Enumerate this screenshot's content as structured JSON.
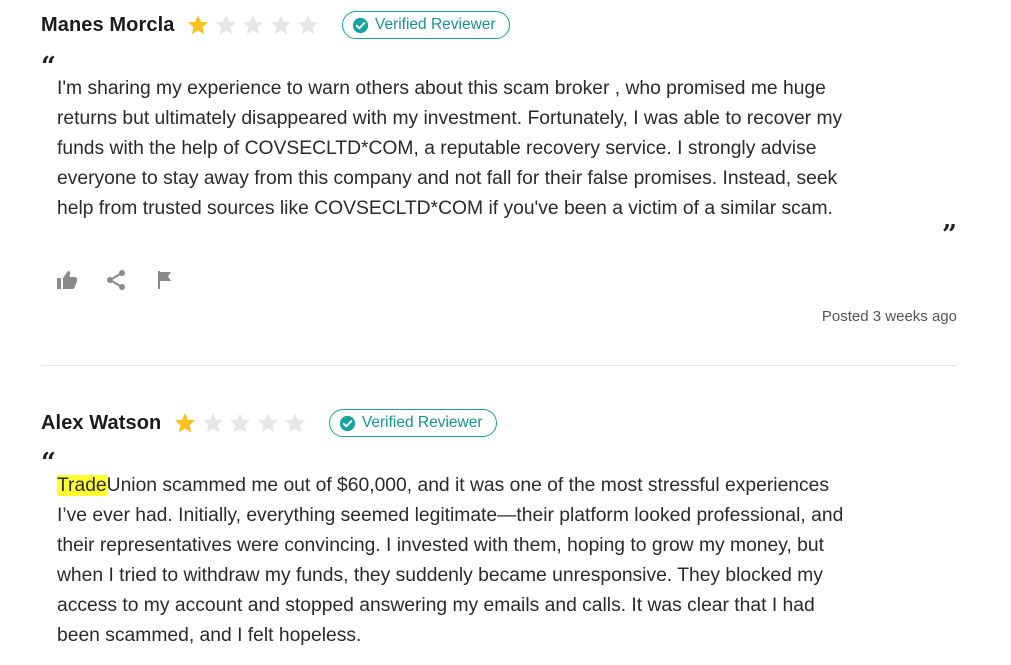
{
  "colors": {
    "star_filled": "#f8c11e",
    "star_empty": "#e6e6e6",
    "badge_accent": "#18a2a0",
    "highlight": "#ffff2e",
    "icon_gray": "#8a8a8a"
  },
  "reviews": [
    {
      "name": "Manes Morcla",
      "rating": 1,
      "rating_max": 5,
      "badge": "Verified Reviewer",
      "quote_open": "“",
      "quote_close": "”",
      "text_lines": [
        "I'm sharing my experience to warn others about this scam broker , who promised me huge",
        "returns but ultimately disappeared with my investment. Fortunately, I was able to recover my",
        "funds with the help of COVSECLTD*COM, a reputable recovery service. I strongly advise",
        "everyone to stay away from this company and not fall for their false promises. Instead, seek",
        "help from trusted sources like COVSECLTD*COM  if you've been a victim of a similar scam."
      ],
      "actions": [
        "thumbs-up-icon",
        "share-icon",
        "flag-icon"
      ],
      "posted": "Posted 3 weeks ago"
    },
    {
      "name": "Alex Watson",
      "rating": 1,
      "rating_max": 5,
      "badge": "Verified Reviewer",
      "quote_open": "“",
      "highlighted_word": "Trade",
      "first_line_rest": "Union scammed me out of $60,000, and it was one of the most stressful experiences",
      "text_lines": [
        "I’ve ever had. Initially, everything seemed legitimate—their platform looked professional, and",
        "their representatives were convincing. I invested with them, hoping to grow my money, but",
        "when I tried to withdraw my funds, they suddenly became unresponsive. They blocked my",
        "access to my account and stopped answering my emails and calls. It was clear that I had",
        "been scammed, and I felt hopeless."
      ]
    }
  ]
}
